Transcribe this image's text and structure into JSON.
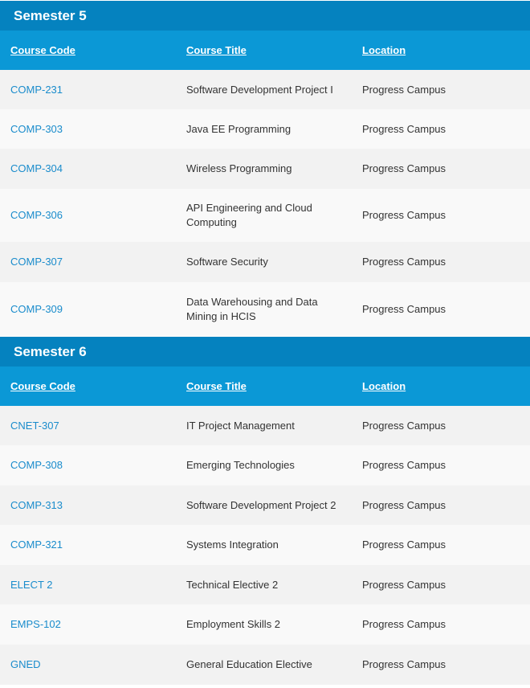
{
  "colors": {
    "header_dark": "#0582bf",
    "header_light": "#0b98d6",
    "link": "#1a8ccc",
    "row_odd": "#f2f2f2",
    "row_even": "#f9f9f9"
  },
  "semesters": [
    {
      "title": "Semester 5",
      "headers": {
        "code": "Course Code",
        "title": "Course Title",
        "location": "Location"
      },
      "rows": [
        {
          "code": "COMP-231",
          "title": "Software Development Project I",
          "location": "Progress Campus"
        },
        {
          "code": "COMP-303",
          "title": "Java EE Programming",
          "location": "Progress Campus"
        },
        {
          "code": "COMP-304",
          "title": "Wireless Programming",
          "location": "Progress Campus"
        },
        {
          "code": "COMP-306",
          "title": "API Engineering and Cloud Computing",
          "location": "Progress Campus"
        },
        {
          "code": "COMP-307",
          "title": "Software Security",
          "location": "Progress Campus"
        },
        {
          "code": "COMP-309",
          "title": "Data Warehousing and Data Mining in HCIS",
          "location": "Progress Campus"
        }
      ]
    },
    {
      "title": "Semester 6",
      "headers": {
        "code": "Course Code",
        "title": "Course Title",
        "location": "Location"
      },
      "rows": [
        {
          "code": "CNET-307",
          "title": "IT Project Management",
          "location": "Progress Campus"
        },
        {
          "code": "COMP-308",
          "title": "Emerging Technologies",
          "location": "Progress Campus"
        },
        {
          "code": "COMP-313",
          "title": "Software Development Project 2",
          "location": "Progress Campus"
        },
        {
          "code": "COMP-321",
          "title": "Systems Integration",
          "location": "Progress Campus"
        },
        {
          "code": "ELECT 2",
          "title": "Technical Elective 2",
          "location": "Progress Campus"
        },
        {
          "code": "EMPS-102",
          "title": "Employment Skills 2",
          "location": "Progress Campus"
        },
        {
          "code": "GNED",
          "title": "General Education Elective",
          "location": "Progress Campus"
        }
      ]
    }
  ]
}
